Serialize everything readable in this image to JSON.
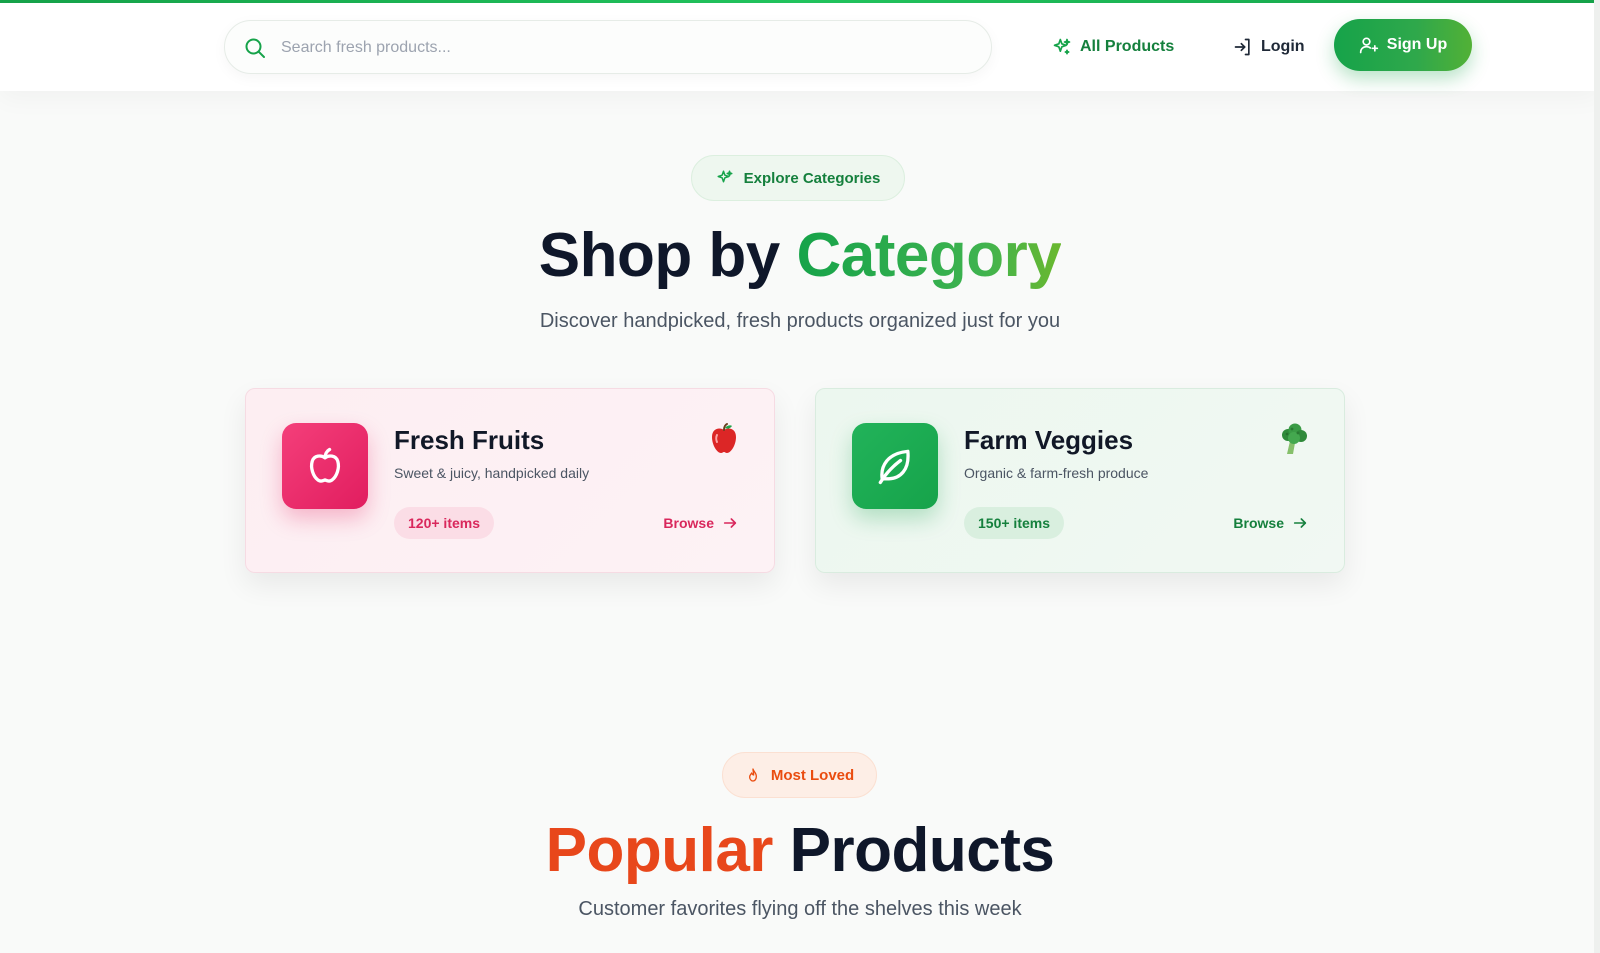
{
  "header": {
    "search_placeholder": "Search fresh products...",
    "nav_all_products": "All Products",
    "nav_login": "Login",
    "nav_signup": "Sign Up"
  },
  "categories_section": {
    "pill": "Explore Categories",
    "title_main": "Shop by ",
    "title_accent": "Category",
    "subtitle": "Discover handpicked, fresh products organized just for you",
    "cards": [
      {
        "title": "Fresh Fruits",
        "description": "Sweet & juicy, handpicked daily",
        "count": "120+ items",
        "action": "Browse",
        "icon": "apple-icon",
        "emoji": "red-apple-emoji",
        "accent": "#e11d5f"
      },
      {
        "title": "Farm Veggies",
        "description": "Organic & farm-fresh produce",
        "count": "150+ items",
        "action": "Browse",
        "icon": "leaf-icon",
        "emoji": "broccoli-emoji",
        "accent": "#16a34a"
      }
    ]
  },
  "popular_section": {
    "pill": "Most Loved",
    "title_accent": "Popular",
    "title_main": " Products",
    "subtitle": "Customer favorites flying off the shelves this week"
  },
  "colors": {
    "brand_green": "#16a34a",
    "accent_pink": "#e11d5f",
    "accent_orange": "#e8471b",
    "heading": "#0f172a"
  }
}
